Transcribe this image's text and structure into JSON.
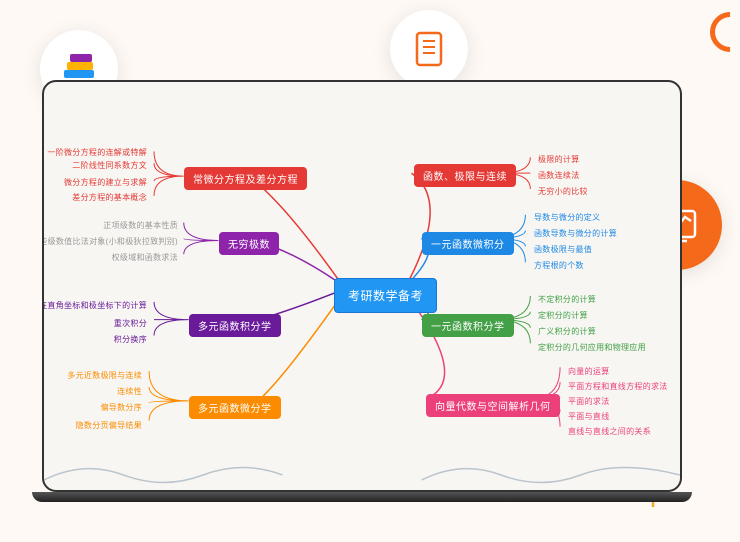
{
  "root": "考研数学备考",
  "left": [
    {
      "label": "常微分方程及差分方程",
      "color": "red",
      "leaves": [
        "一阶微分方程的连解或特解",
        "二阶线性同系数方文",
        "微分方程的建立与求解",
        "差分方程的基本概念"
      ]
    },
    {
      "label": "无穷极数",
      "color": "purple",
      "leaves": [
        "正项级数的基本性质",
        "一些级数值比法对象(小和极狄拉致判别)",
        "权级域和函数求法"
      ]
    },
    {
      "label": "多元函数积分学",
      "color": "violet",
      "leaves": [
        "二重积分在直角坐标和极坐标下的计算",
        "重次积分",
        "积分换序"
      ]
    },
    {
      "label": "多元函数微分学",
      "color": "orange",
      "leaves": [
        "多元近数极限与连续",
        "连续性",
        "偏导数分序",
        "隐数分页偏导结果"
      ]
    }
  ],
  "right": [
    {
      "label": "函数、极限与连续",
      "color": "red",
      "leaves": [
        "极限的计算",
        "函数连续法",
        "无穷小的比较"
      ]
    },
    {
      "label": "一元函数微积分",
      "color": "blue",
      "leaves": [
        "导数与微分的定义",
        "函数导数与微分的计算",
        "函数极限与最值",
        "方程根的个数"
      ]
    },
    {
      "label": "一元函数积分学",
      "color": "green",
      "leaves": [
        "不定积分的计算",
        "定积分的计算",
        "广义积分的计算",
        "定积分的几何应用和物理应用"
      ]
    },
    {
      "label": "向量代数与空间解析几何",
      "color": "pink",
      "leaves": [
        "向量的运算",
        "平面方程和直线方程的求法",
        "平面的求法",
        "平面与直线",
        "直线与直线之间的关系"
      ]
    }
  ],
  "icons": {
    "books": "books-icon",
    "notebook": "notebook-icon",
    "chart": "chart-icon",
    "bulb": "bulb-icon"
  }
}
